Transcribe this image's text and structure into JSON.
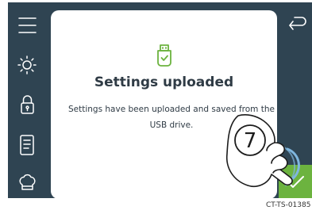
{
  "dialog": {
    "title": "Settings uploaded",
    "message": "Settings have been uploaded and saved from the USB drive.",
    "icon": "usb-check-icon"
  },
  "left_rail": {
    "items": [
      {
        "icon": "menu-icon"
      },
      {
        "icon": "brightness-icon"
      },
      {
        "icon": "lock-icon"
      },
      {
        "icon": "recipe-book-icon"
      },
      {
        "icon": "chef-hat-icon"
      }
    ]
  },
  "right_rail": {
    "back_icon": "back-arrow-icon",
    "confirm_icon": "checkmark-icon"
  },
  "annotation": {
    "step_number": "7",
    "footer_code": "CT-TS-01385"
  },
  "colors": {
    "rail": "#2f4452",
    "accent_green": "#6cb33f",
    "text": "#2f3b45",
    "callout_blue": "#7fb6de"
  }
}
